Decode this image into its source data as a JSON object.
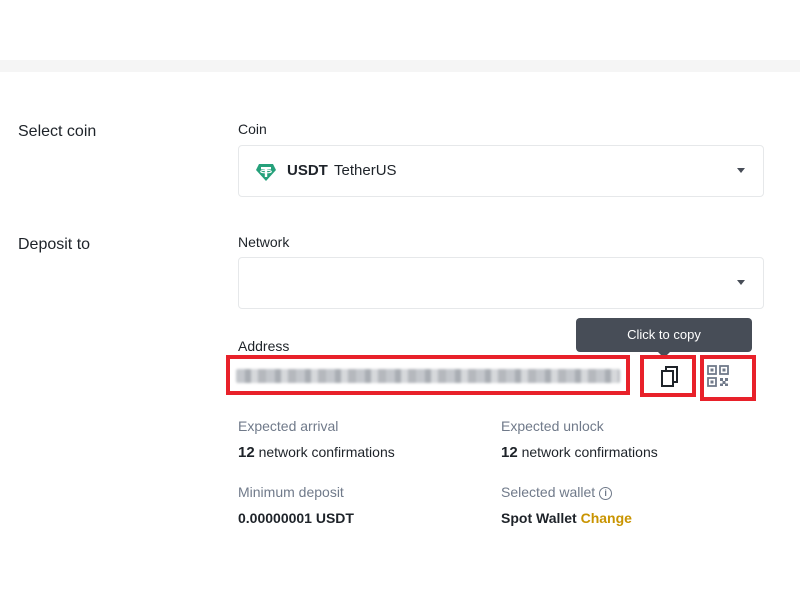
{
  "sections": {
    "select_coin": "Select coin",
    "deposit_to": "Deposit to"
  },
  "coin": {
    "label": "Coin",
    "symbol": "USDT",
    "name": "TetherUS",
    "icon": "tether-icon",
    "icon_color": "#26a17b"
  },
  "network": {
    "label": "Network",
    "value": ""
  },
  "address": {
    "label": "Address",
    "copy_tooltip": "Click to copy",
    "copy_icon": "copy-icon",
    "qr_icon": "qr-code-icon"
  },
  "details": {
    "expected_arrival": {
      "label": "Expected arrival",
      "count": "12",
      "text": "network confirmations"
    },
    "expected_unlock": {
      "label": "Expected unlock",
      "count": "12",
      "text": "network confirmations"
    },
    "minimum_deposit": {
      "label": "Minimum deposit",
      "value": "0.00000001 USDT"
    },
    "selected_wallet": {
      "label": "Selected wallet",
      "value": "Spot Wallet",
      "change_label": "Change"
    }
  },
  "colors": {
    "highlight": "#e8212a",
    "accent": "#c99400",
    "tooltip_bg": "#474d57"
  }
}
